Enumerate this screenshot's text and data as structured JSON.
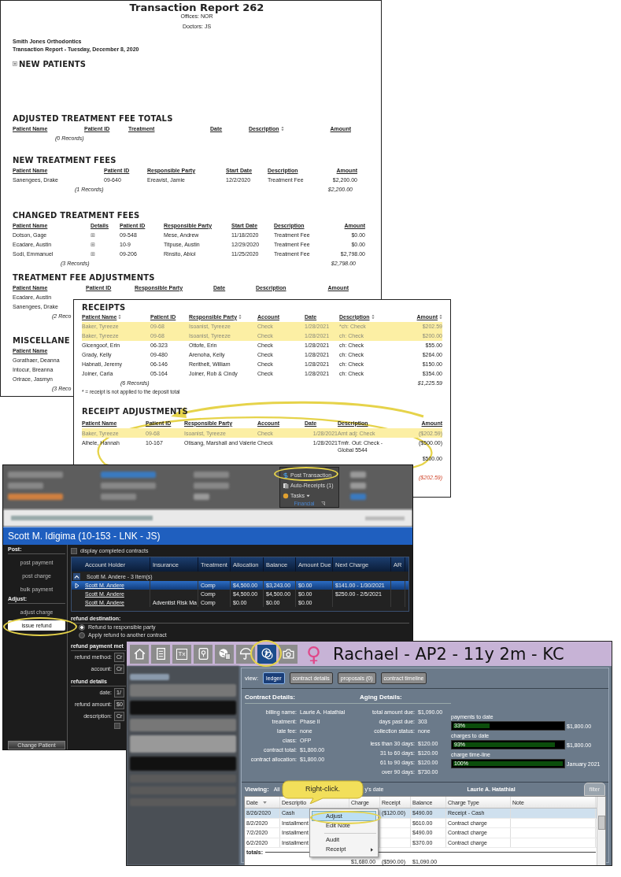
{
  "report": {
    "title": "Transaction Report 262",
    "offices": "Offices: NOR",
    "doctors": "Doctors: JS",
    "practice": "Smith Jones Orthodontics",
    "subtitle": "Transaction Report -  Tuesday, December 8, 2020",
    "sections": [
      {
        "title": "NEW PATIENTS",
        "expandable": true
      },
      {
        "title": "ADJUSTED TREATMENT FEE TOTALS",
        "columns": [
          {
            "label": "Patient Name"
          },
          {
            "label": "Patient ID"
          },
          {
            "label": "Treatment"
          },
          {
            "label": "Date"
          },
          {
            "label": "Description",
            "sortable": true
          },
          {
            "label": "Amount"
          }
        ],
        "records": "(0 Records)"
      },
      {
        "title": "NEW TREATMENT FEES",
        "columns": [
          {
            "label": "Patient Name"
          },
          {
            "label": "Patient ID"
          },
          {
            "label": "Responsible Party"
          },
          {
            "label": "Start Date"
          },
          {
            "label": "Description"
          },
          {
            "label": "Amount"
          }
        ],
        "rows": [
          [
            "Sanengees, Drake",
            "09-640",
            "Ereavist, Jamie",
            "12/2/2020",
            "Treatment Fee",
            "$2,200.00"
          ]
        ],
        "records": "(1 Records)",
        "total": "$2,200.00"
      },
      {
        "title": "CHANGED TREATMENT FEES",
        "columns": [
          {
            "label": "Patient Name"
          },
          {
            "label": "Details"
          },
          {
            "label": "Patient ID"
          },
          {
            "label": "Responsible Party"
          },
          {
            "label": "Start Date"
          },
          {
            "label": "Description"
          },
          {
            "label": "Amount"
          }
        ],
        "rows": [
          [
            "Dotson, Gage",
            "⊞",
            "09-548",
            "Mese, Andrew",
            "11/18/2020",
            "Treatment Fee",
            "$0.00"
          ],
          [
            "Ecadare, Austin",
            "⊞",
            "10-9",
            "Titpuse, Austin",
            "12/29/2020",
            "Treatment Fee",
            "$0.00"
          ],
          [
            "Sodi, Emmanuel",
            "⊞",
            "09-206",
            "Rinsito, Abiol",
            "11/25/2020",
            "Treatment Fee",
            "$2,798.00"
          ]
        ],
        "records": "(3 Records)",
        "total": "$2,798.00"
      },
      {
        "title": "TREATMENT FEE ADJUSTMENTS",
        "columns": [
          {
            "label": "Patient Name"
          },
          {
            "label": "Patient ID"
          },
          {
            "label": "Responsible Party"
          },
          {
            "label": "Date"
          },
          {
            "label": "Description"
          },
          {
            "label": "Amount"
          }
        ],
        "rows": [
          [
            "Ecadare, Austin"
          ],
          [
            "Sanengees, Drake"
          ]
        ],
        "records": "(2 Reco"
      },
      {
        "title": "MISCELLANE",
        "columns": [
          {
            "label": "Patient Name"
          }
        ],
        "rows": [
          [
            "Gorathaer, Deanna"
          ],
          [
            "Intocur, Breanna"
          ],
          [
            "Orirace, Jasmyn"
          ]
        ],
        "records": "(3 Reco"
      }
    ]
  },
  "receipts": {
    "title": "RECEIPTS",
    "columns": [
      {
        "label": "Patient Name",
        "sortable": true
      },
      {
        "label": "Patient ID"
      },
      {
        "label": "Responsible Party",
        "sortable": true
      },
      {
        "label": "Account"
      },
      {
        "label": "Date"
      },
      {
        "label": "Description",
        "sortable": true
      },
      {
        "label": "Amount",
        "sortable": true
      }
    ],
    "rows": [
      {
        "highlighted": true,
        "cells": [
          "Baker, Tyreeze",
          "09-68",
          "Isoanist, Tyreeze",
          "Check",
          "1/28/2021",
          "*ch: Check",
          "$202.59"
        ]
      },
      {
        "highlighted": true,
        "cells": [
          "Baker, Tyreeze",
          "09-68",
          "Isoanist, Tyreeze",
          "Check",
          "1/28/2021",
          "ch: Check",
          "$200.00"
        ]
      },
      {
        "highlighted": false,
        "cells": [
          "Gicengoof, Erin",
          "06-323",
          "Ottofe, Erin",
          "Check",
          "1/28/2021",
          "ch: Check",
          "$55.00"
        ]
      },
      {
        "highlighted": false,
        "cells": [
          "Grady, Kelly",
          "09-480",
          "Arenoha, Kelly",
          "Check",
          "1/28/2021",
          "ch: Check",
          "$264.00"
        ]
      },
      {
        "highlighted": false,
        "cells": [
          "Habnati, Jeremy",
          "06-146",
          "Rerithelt, William",
          "Check",
          "1/28/2021",
          "ch: Check",
          "$150.00"
        ]
      },
      {
        "highlighted": false,
        "cells": [
          "Joiner, Carla",
          "05-164",
          "Joiner, Rob & Cindy",
          "Check",
          "1/28/2021",
          "ch: Check",
          "$354.00"
        ]
      }
    ],
    "records": "(6 Records)",
    "total": "$1,225.59",
    "footnote": "* = receipt is not applied to the deposit total",
    "adjustments": {
      "title": "RECEIPT ADJUSTMENTS",
      "columns": [
        {
          "label": "Patient Name"
        },
        {
          "label": "Patient ID"
        },
        {
          "label": "Responsible Party"
        },
        {
          "label": "Account"
        },
        {
          "label": "Date"
        },
        {
          "label": "Description"
        },
        {
          "label": "Amount"
        }
      ],
      "rows": [
        {
          "highlighted": true,
          "cells": [
            "Baker, Tyreeze",
            "09-68",
            "Isoanist, Tyreeze",
            "Check",
            "1/28/2021",
            "Amt adj: Check",
            "($202.59)"
          ]
        },
        {
          "highlighted": false,
          "cells": [
            "Alhele, Hannah",
            "10-167",
            "Otisang, Marshall and Valerie",
            "Check",
            "1/28/2021",
            "Tmfr. Out: Check - Global 5544",
            "($500.00)"
          ]
        }
      ],
      "partial_amount": "$500.00",
      "total": "($202.59)"
    }
  },
  "post_window": {
    "ribbon": {
      "items": [
        {
          "label": "Post Transaction",
          "kind": "dollar"
        },
        {
          "label": "Auto-Receipts (1)",
          "kind": "receipts"
        },
        {
          "label": "Tasks",
          "kind": "tasks"
        }
      ],
      "group": "Financial"
    },
    "header": "Scott M. Idigima (10-153 - LNK - JS)",
    "sidebar": [
      {
        "heading": "Post:",
        "items": [
          {
            "label": "post payment",
            "selected": false
          },
          {
            "label": "post charge",
            "selected": false
          },
          {
            "label": "bulk payment",
            "selected": false
          }
        ]
      },
      {
        "heading": "Adjust:",
        "items": [
          {
            "label": "adjust charge",
            "selected": false
          },
          {
            "label": "issue refund",
            "selected": true
          }
        ]
      }
    ],
    "change_patient": "Change Patient",
    "completed": {
      "label": "display completed contracts",
      "checked": false
    },
    "columns": [
      "Account Holder",
      "Insurance",
      "Treatment",
      "Allocation",
      "Balance",
      "Amount Due",
      "Next Charge",
      "AR"
    ],
    "group": {
      "label": "Scott M. Andere  - 3 Item(s)",
      "expanded": true
    },
    "rows": [
      {
        "selected": true,
        "holder": "Scott M. Andere",
        "treatment": "Comp",
        "allocation": "$4,500.00",
        "balance": "$3,243.00",
        "due": "$0.00",
        "next": "$141.00 - 1/30/2021"
      },
      {
        "selected": false,
        "holder": "Scott M. Andere",
        "treatment": "Comp",
        "allocation": "$4,500.00",
        "balance": "$4,500.00",
        "due": "$0.00",
        "next": "$250.00 - 2/5/2021"
      },
      {
        "selected": false,
        "holder": "Scott M. Andere",
        "insurance": "Adventist Risk Ma",
        "treatment": "Comp",
        "allocation": "$0.00",
        "balance": "$0.00",
        "due": "$0.00"
      }
    ],
    "destination": {
      "heading": "refund destination:",
      "options": [
        {
          "label": "Refund to responsible party",
          "selected": true
        },
        {
          "label": "Apply refund to another contract",
          "selected": false
        }
      ]
    },
    "form_sections": [
      {
        "heading": "refund payment met",
        "fields": [
          {
            "label": "refund method:",
            "value": "Cr"
          },
          {
            "label": "account:",
            "value": "Cr"
          }
        ]
      },
      {
        "heading": "refund details",
        "fields": [
          {
            "label": "date:",
            "value": "1/"
          },
          {
            "label": "refund amount:",
            "value": "$0"
          },
          {
            "label": "description:",
            "value": "Cr"
          }
        ]
      }
    ],
    "extra_checkbox": {
      "checked": false
    }
  },
  "patient_window": {
    "toolbar": [
      {
        "kind": "home",
        "selected": false
      },
      {
        "kind": "list",
        "selected": false
      },
      {
        "kind": "label",
        "label": "Tx",
        "selected": false
      },
      {
        "kind": "keyhole",
        "selected": false
      },
      {
        "kind": "globe",
        "selected": false
      },
      {
        "kind": "umbrella",
        "selected": false
      },
      {
        "kind": "coins",
        "selected": true
      },
      {
        "kind": "camera",
        "selected": false
      }
    ],
    "gender_symbol": "♀",
    "title": "Rachael - AP2 - 11y 2m - KC",
    "view_label": "view:",
    "view_buttons": [
      {
        "label": "ledger",
        "selected": true
      },
      {
        "label": "contract details",
        "selected": false
      },
      {
        "label": "proposals (0)",
        "selected": false
      },
      {
        "label": "contract timeline",
        "selected": false
      }
    ],
    "contract_details": {
      "heading": "Contract Details:",
      "rows": [
        {
          "label": "billing name:",
          "value": "Laurie A. Hatathial"
        },
        {
          "label": "treatment:",
          "value": "Phase II"
        },
        {
          "label": "late fee:",
          "value": "none"
        },
        {
          "label": "class:",
          "value": "OFP"
        },
        {
          "label": "contract total:",
          "value": "$1,800.00"
        },
        {
          "label": "contract allocation:",
          "value": "$1,800.00"
        }
      ]
    },
    "aging_details": {
      "heading": "Aging Details:",
      "rows": [
        {
          "label": "total amount due:",
          "value": "$1,090.00"
        },
        {
          "label": "days past due:",
          "value": "303"
        },
        {
          "label": "collection status:",
          "value": "none"
        },
        {
          "label": "less than 30 days:",
          "value": "$120.00",
          "gap_before": true
        },
        {
          "label": "31 to 60 days:",
          "value": "$120.00"
        },
        {
          "label": "61 to 90 days:",
          "value": "$120.00"
        },
        {
          "label": "over 90 days:",
          "value": "$730.00"
        }
      ]
    },
    "progress": [
      {
        "label": "payments to date",
        "text": "33%",
        "level": 0.33,
        "reading": "$1,800.00"
      },
      {
        "label": "charges to date",
        "text": "93%",
        "level": 0.93,
        "reading": "$1,800.00"
      },
      {
        "label": "charge time-line",
        "text": "100%",
        "level": 1,
        "reading": "January 2021"
      }
    ],
    "viewing": {
      "label": "Viewing:",
      "prefix": "All",
      "suffix": "y's date",
      "party": "Laurie A. Hatathial",
      "filter": "filter"
    },
    "ledger": {
      "columns": [
        {
          "label": "Date",
          "sortable": true
        },
        {
          "label": "Descriptio"
        },
        {
          "label": "Charge"
        },
        {
          "label": "Receipt"
        },
        {
          "label": "Balance"
        },
        {
          "label": "Charge Type"
        },
        {
          "label": "Note"
        }
      ],
      "rows": [
        {
          "selected": true,
          "date": "8/26/2020",
          "description": "Cash",
          "receipt": "($120.00)",
          "balance": "$490.00",
          "type": "Receipt - Cash"
        },
        {
          "selected": false,
          "date": "8/2/2020",
          "description": "Installment",
          "balance": "$610.00",
          "type": "Contract charge"
        },
        {
          "selected": false,
          "date": "7/2/2020",
          "description": "Installment",
          "balance": "$490.00",
          "type": "Contract charge"
        },
        {
          "selected": false,
          "date": "6/2/2020",
          "description": "Installment",
          "balance": "$370.00",
          "type": "Contract charge"
        }
      ],
      "totals_label": "totals:",
      "totals": {
        "charge": "$1,680.00",
        "receipt": "($590.00)",
        "balance": "$1,090.00"
      }
    },
    "context_menu": [
      {
        "label": "Adjust",
        "highlighted": true
      },
      {
        "label": "Edit Note",
        "highlighted": false
      },
      {
        "label": "Audit",
        "highlighted": false,
        "divider_before": true
      },
      {
        "label": "Receipt",
        "highlighted": false,
        "submenu": true
      }
    ],
    "callout": "Right-click."
  }
}
